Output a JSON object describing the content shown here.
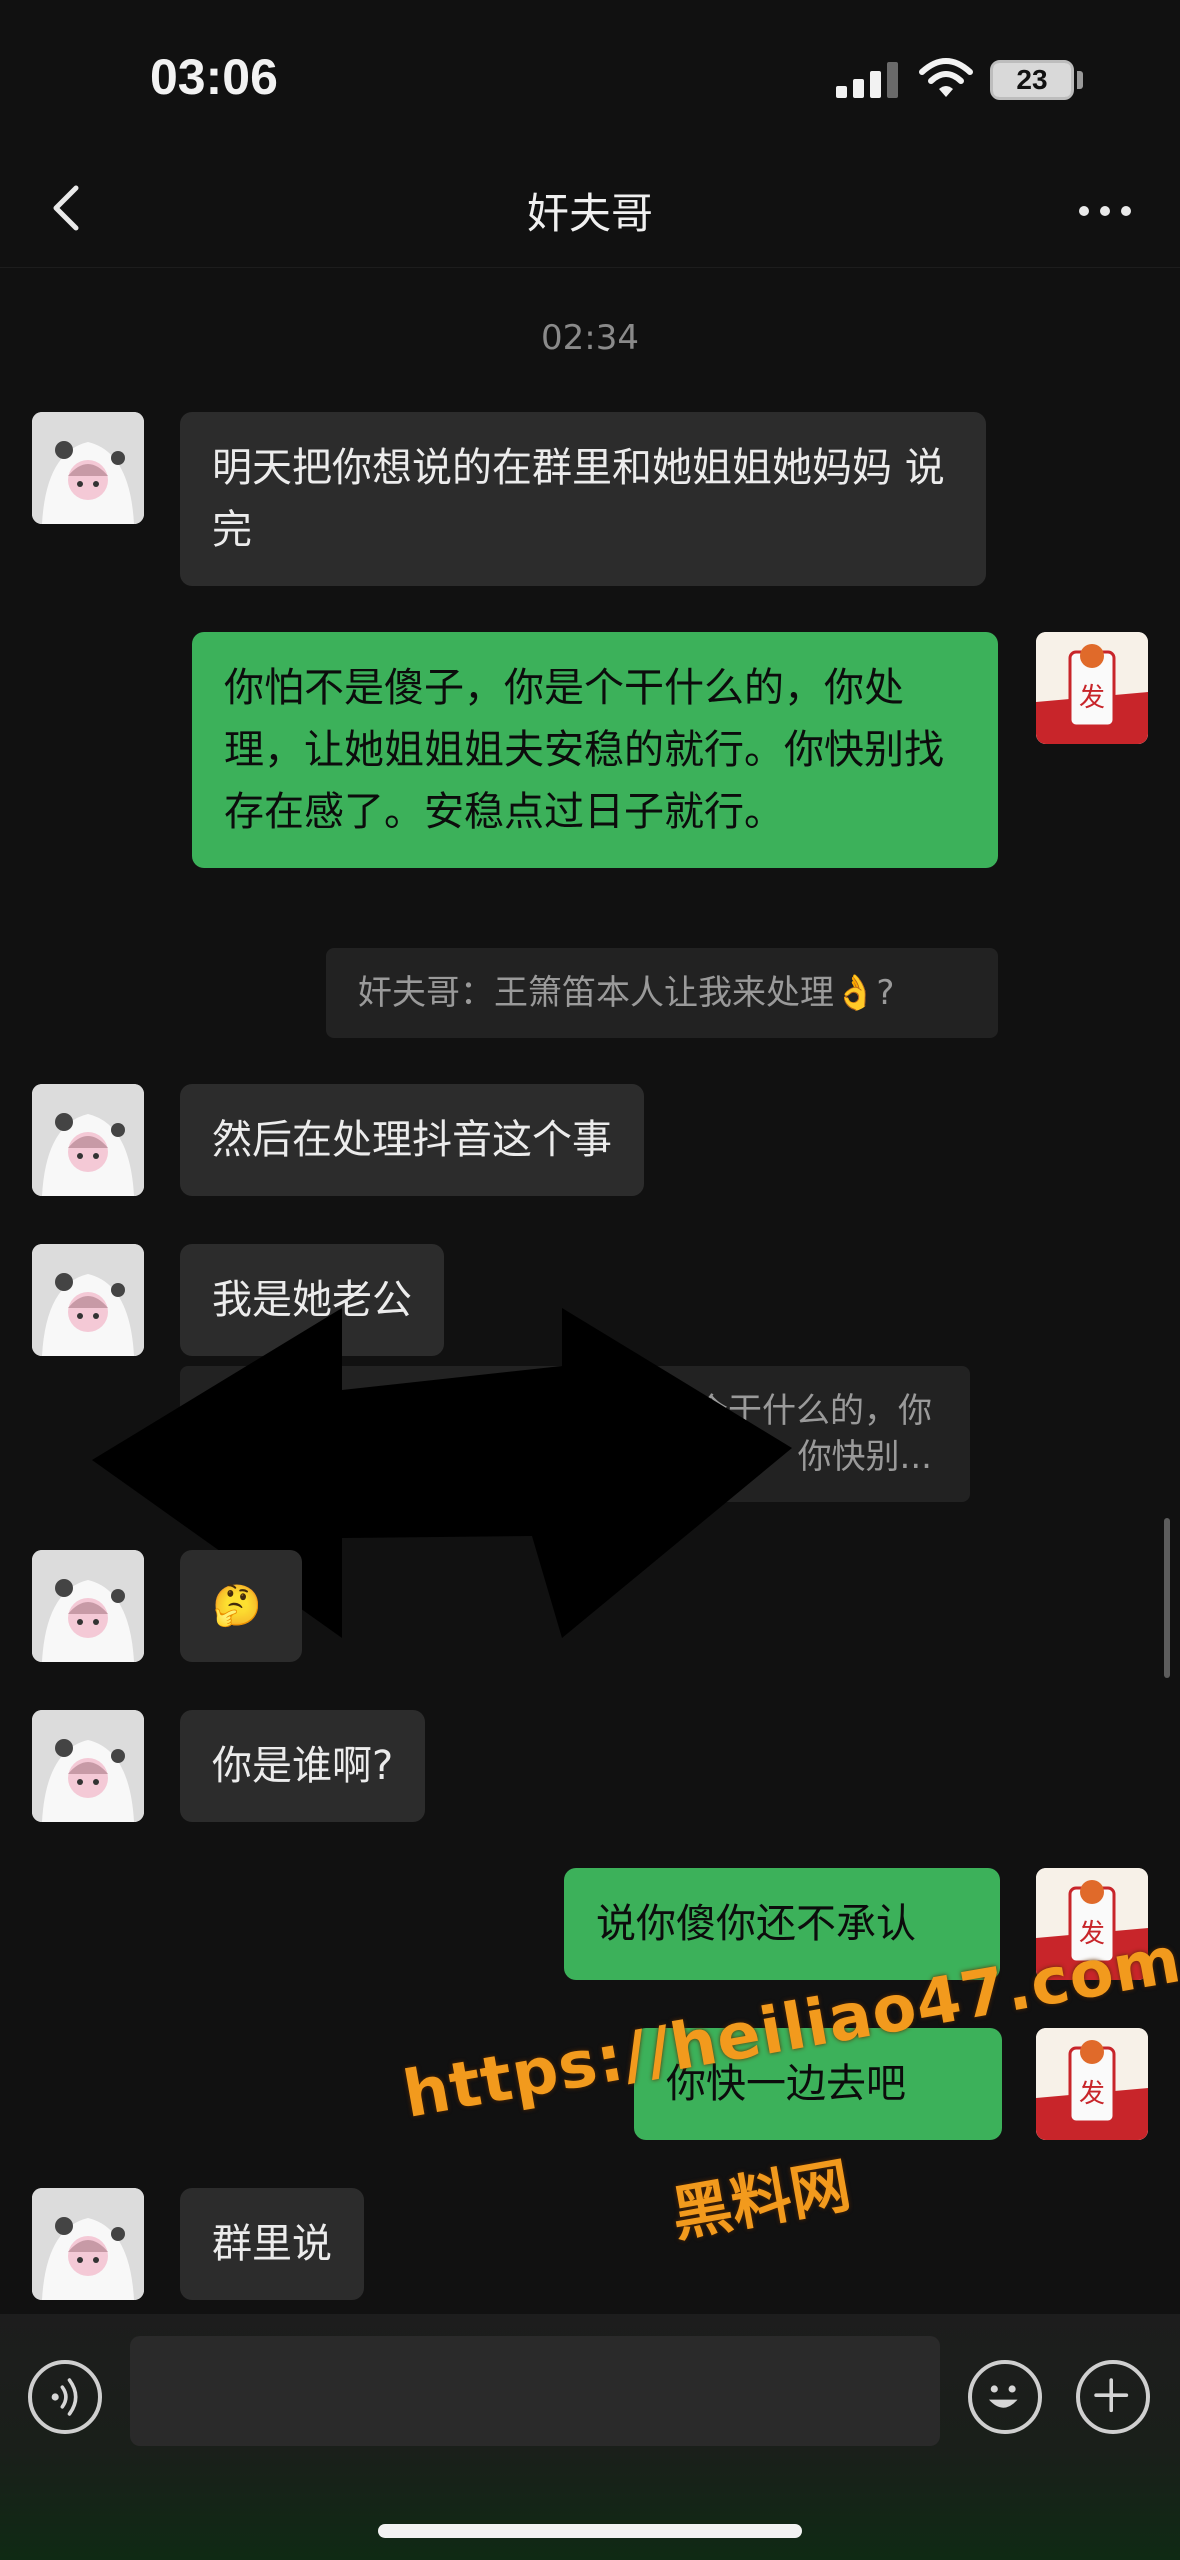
{
  "status_bar": {
    "time": "03:06",
    "battery_level": "23",
    "icons": [
      "signal-icon",
      "wifi-icon",
      "battery-icon"
    ]
  },
  "nav": {
    "title": "奸夫哥",
    "back_icon": "chevron-left-icon",
    "more_icon": "more-dots-icon"
  },
  "chat": {
    "timestamp": "02:34",
    "messages": [
      {
        "side": "in",
        "text": "明天把你想说的在群里和她姐姐她妈妈 说完"
      },
      {
        "side": "out",
        "text": "你怕不是傻子，你是个干什么的，你处理，让她姐姐姐夫安稳的就行。你快别找存在感了。安稳点过日子就行。"
      },
      {
        "side": "in",
        "text": "然后在处理抖音这个事"
      },
      {
        "side": "in",
        "text": "我是她老公"
      },
      {
        "side": "in",
        "text": "🤔"
      },
      {
        "side": "in",
        "text": "你是谁啊?"
      },
      {
        "side": "out",
        "text": "说你傻你还不承认"
      },
      {
        "side": "out",
        "text": "你快一边去吧"
      },
      {
        "side": "in",
        "text": "群里说"
      }
    ],
    "quotes": [
      {
        "text": "奸夫哥：王箫笛本人让我来处理👌?"
      },
      {
        "line1": "个干什么的，你",
        "line2": "你快别..."
      }
    ]
  },
  "watermark": {
    "url": "https://heiliao47.com",
    "text": "黑料网"
  },
  "input_bar": {
    "placeholder": "",
    "voice_icon": "voice-icon",
    "emoji_icon": "emoji-icon",
    "plus_icon": "plus-icon"
  },
  "colors": {
    "background": "#111111",
    "incoming_bubble": "#2c2c2c",
    "outgoing_bubble": "#3cb15a",
    "watermark": "#f29a1d"
  }
}
